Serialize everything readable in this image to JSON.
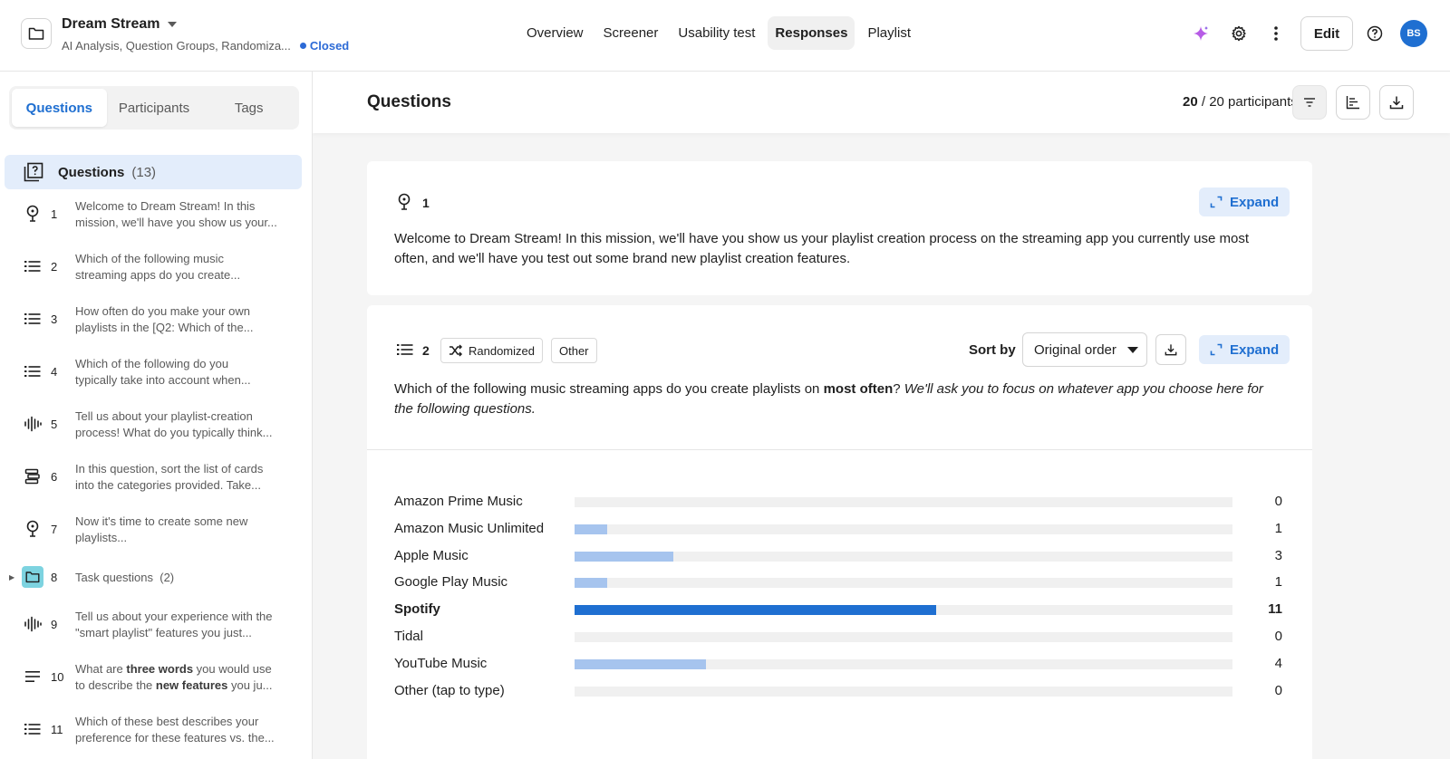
{
  "header": {
    "project_title": "Dream Stream",
    "project_subtitle": "AI Analysis, Question Groups, Randomiza...",
    "status": "Closed",
    "nav": [
      "Overview",
      "Screener",
      "Usability test",
      "Responses",
      "Playlist"
    ],
    "active_nav": "Responses",
    "edit_label": "Edit",
    "avatar_initials": "BS"
  },
  "sidebar": {
    "tabs": [
      "Questions",
      "Participants",
      "Tags"
    ],
    "active_tab": "Questions",
    "questions_label": "Questions",
    "questions_count": "(13)",
    "items": [
      {
        "num": "1",
        "icon": "lightbulb-icon",
        "line1": "Welcome to Dream Stream! In this",
        "line2": "mission, we'll have you show us your..."
      },
      {
        "num": "2",
        "icon": "list-icon",
        "line1": "Which of the following music",
        "line2": "streaming apps do you create..."
      },
      {
        "num": "3",
        "icon": "list-icon",
        "line1": "How often do you make your own",
        "line2": "playlists in the [Q2: Which of the..."
      },
      {
        "num": "4",
        "icon": "list-icon",
        "line1": "Which of the following do you",
        "line2": "typically take into account when..."
      },
      {
        "num": "5",
        "icon": "audio-wave-icon",
        "line1": "Tell us about your playlist-creation",
        "line2": "process! What do you typically think..."
      },
      {
        "num": "6",
        "icon": "card-sort-icon",
        "line1": "In this question, sort the list of cards",
        "line2": "into the categories provided. Take..."
      },
      {
        "num": "7",
        "icon": "lightbulb-icon",
        "line1": "Now it's time to create some new",
        "line2": "playlists..."
      },
      {
        "num": "8",
        "icon": "folder-icon",
        "line1": "Task questions",
        "count": "(2)"
      },
      {
        "num": "9",
        "icon": "audio-wave-icon",
        "line1": "Tell us about your experience with the",
        "line2": "\"smart playlist\" features you just..."
      },
      {
        "num": "10",
        "icon": "text-icon",
        "line1_a": "What are ",
        "line1_b": "three words",
        "line1_c": " you would use",
        "line2_a": "to describe the ",
        "line2_b": "new features",
        "line2_c": " you ju..."
      },
      {
        "num": "11",
        "icon": "list-icon",
        "line1": "Which of these best describes your",
        "line2": "preference for these features vs. the..."
      }
    ]
  },
  "main": {
    "title": "Questions",
    "participants_count": "20",
    "participants_total": "/ 20 participants",
    "card1": {
      "num": "1",
      "expand_label": "Expand",
      "text": "Welcome to Dream Stream! In this mission, we'll have you show us your playlist creation process on the streaming app you currently use most often, and we'll have you test out some brand new playlist creation features."
    },
    "card2": {
      "num": "2",
      "tag_randomized": "Randomized",
      "tag_other": "Other",
      "sort_label": "Sort by",
      "sort_value": "Original order",
      "expand_label": "Expand",
      "text_a": "Which of the following music streaming apps do you create playlists on ",
      "text_b": "most often",
      "text_c": "? ",
      "text_d": "We'll ask you to focus on whatever app you choose here for the following questions."
    },
    "accent_color": "#1f6fd1",
    "bar_light_color": "#a6c4ee"
  },
  "chart_data": {
    "type": "bar",
    "orientation": "horizontal",
    "categories": [
      "Amazon Prime Music",
      "Amazon Music Unlimited",
      "Apple Music",
      "Google Play Music",
      "Spotify",
      "Tidal",
      "YouTube Music",
      "Other (tap to type)"
    ],
    "values": [
      0,
      1,
      3,
      1,
      11,
      0,
      4,
      0
    ],
    "max": 20,
    "highlight": "Spotify"
  }
}
